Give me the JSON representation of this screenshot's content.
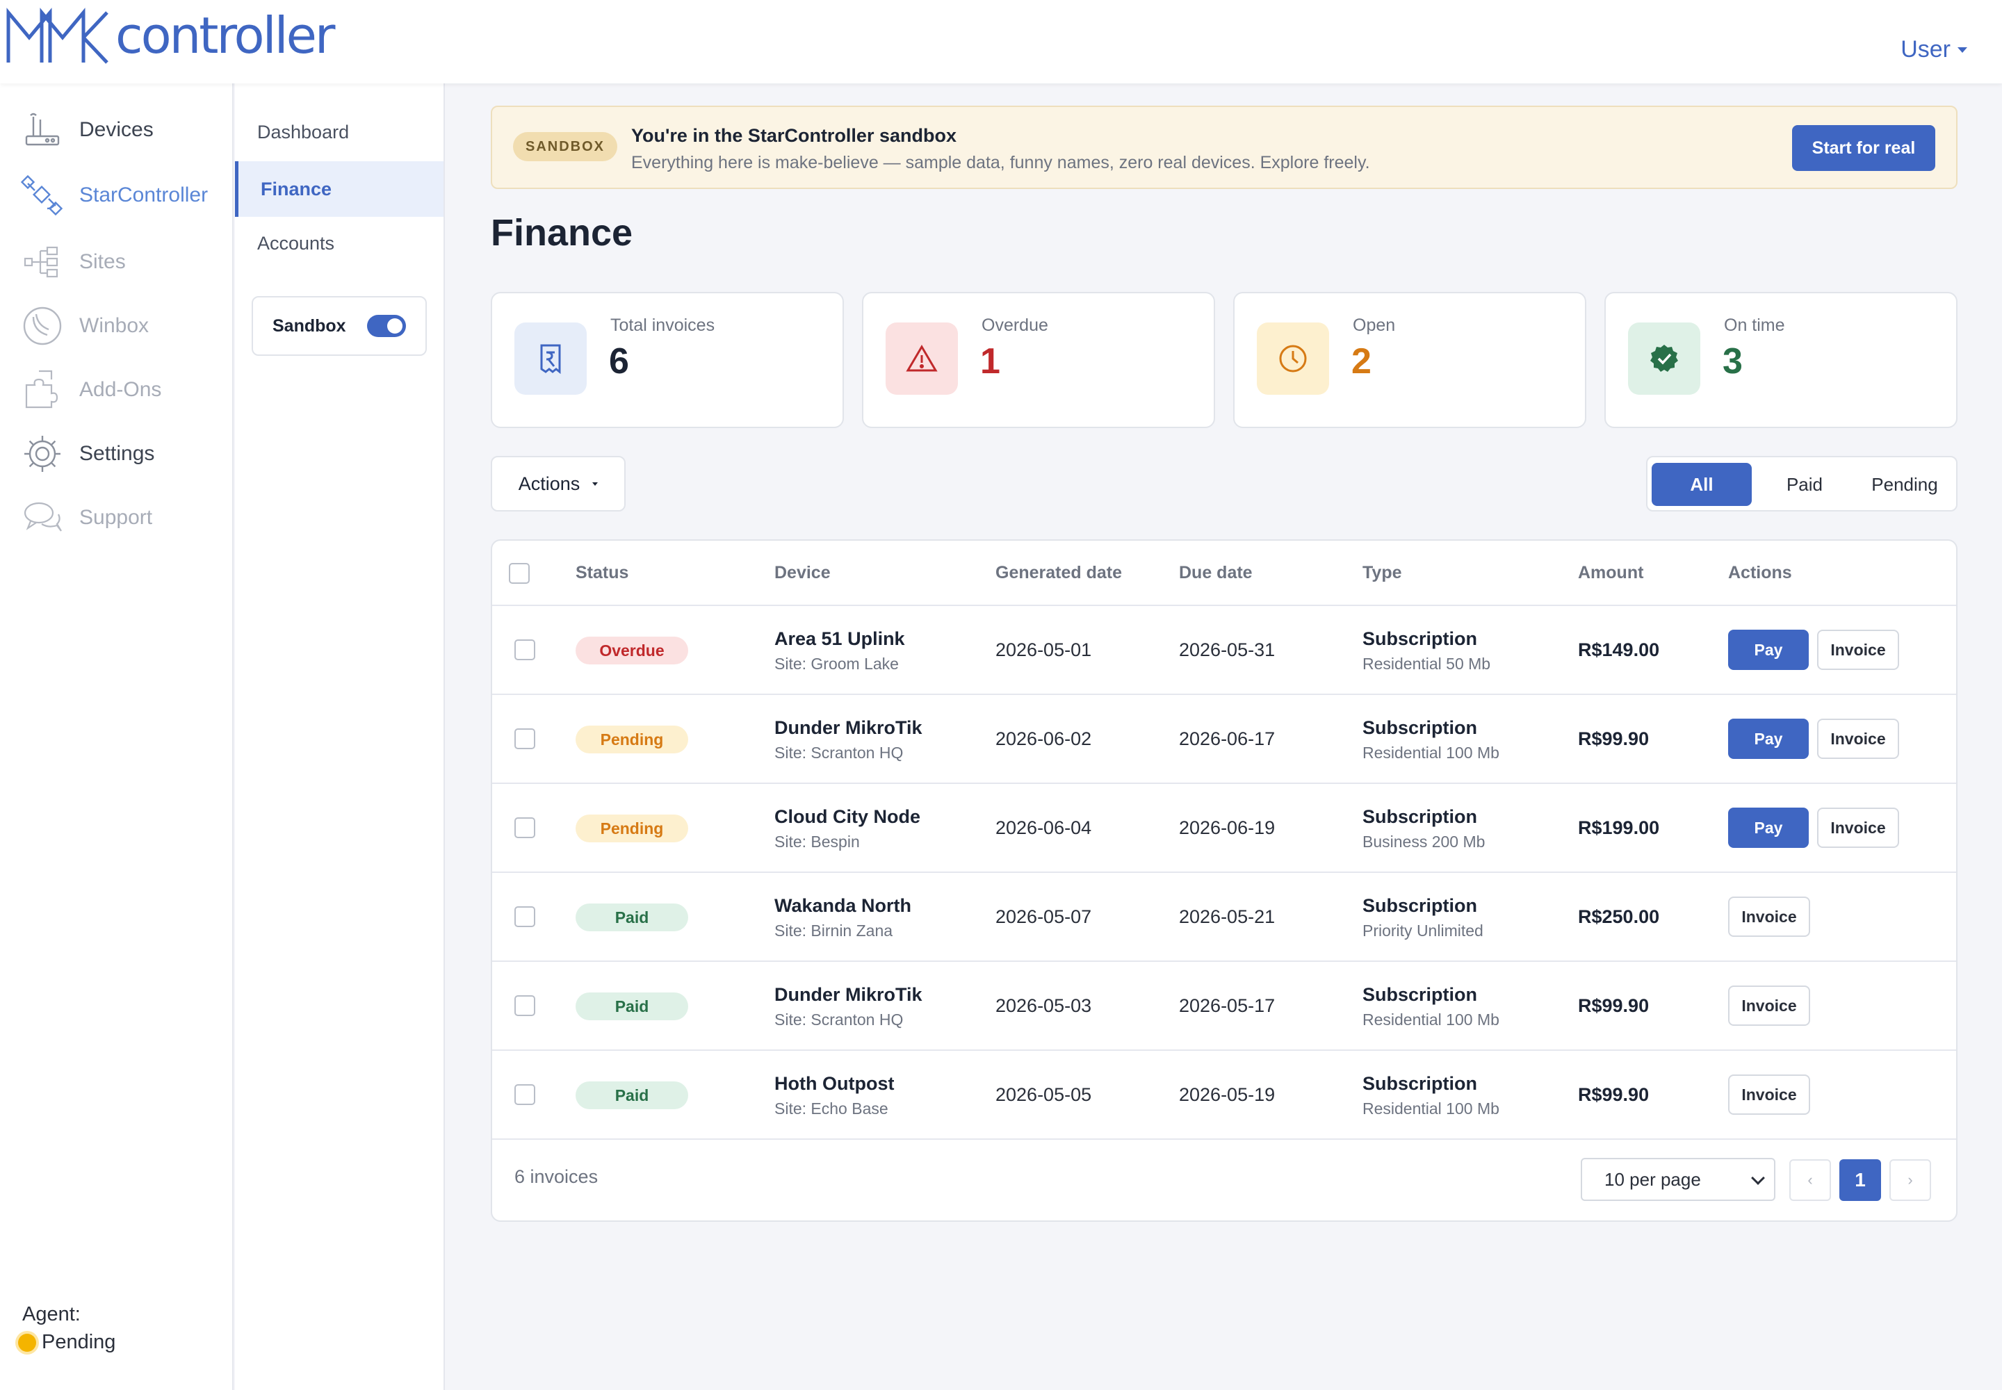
{
  "app": {
    "logo_text": "controller",
    "user_menu": "User"
  },
  "sidebar": {
    "items": [
      {
        "label": "Devices",
        "icon": "router-icon"
      },
      {
        "label": "StarController",
        "icon": "satellite-icon"
      },
      {
        "label": "Sites",
        "icon": "sitemap-icon"
      },
      {
        "label": "Winbox",
        "icon": "winbox-icon"
      },
      {
        "label": "Add-Ons",
        "icon": "puzzle-icon"
      },
      {
        "label": "Settings",
        "icon": "gear-icon"
      },
      {
        "label": "Support",
        "icon": "chat-icon"
      }
    ],
    "agent_label": "Agent:",
    "agent_status": "Pending"
  },
  "subnav": {
    "items": [
      {
        "label": "Dashboard"
      },
      {
        "label": "Finance"
      },
      {
        "label": "Accounts"
      }
    ],
    "sandbox_label": "Sandbox",
    "sandbox_on": true
  },
  "banner": {
    "badge": "SANDBOX",
    "title": "You're in the StarController sandbox",
    "text": "Everything here is make-believe — sample data, funny names, zero real devices. Explore freely.",
    "button": "Start for real"
  },
  "page": {
    "title": "Finance"
  },
  "stats": [
    {
      "label": "Total invoices",
      "value": "6",
      "icon": "receipt-icon",
      "color": "#1c2434",
      "bg": "#e6edf9",
      "icon_color": "#3f66c2"
    },
    {
      "label": "Overdue",
      "value": "1",
      "icon": "warning-icon",
      "color": "#c0292b",
      "bg": "#fbe1e1",
      "icon_color": "#c0292b"
    },
    {
      "label": "Open",
      "value": "2",
      "icon": "clock-icon",
      "color": "#d67a14",
      "bg": "#fdf0cf",
      "icon_color": "#d67a14"
    },
    {
      "label": "On time",
      "value": "3",
      "icon": "check-circle-icon",
      "color": "#287048",
      "bg": "#dff1e7",
      "icon_color": "#287048"
    }
  ],
  "toolbar": {
    "actions_label": "Actions",
    "filters": [
      {
        "label": "All",
        "active": true
      },
      {
        "label": "Paid",
        "active": false
      },
      {
        "label": "Pending",
        "active": false
      }
    ]
  },
  "table": {
    "columns": [
      "Status",
      "Device",
      "Generated date",
      "Due date",
      "Type",
      "Amount",
      "Actions"
    ],
    "pay_label": "Pay",
    "invoice_label": "Invoice",
    "rows": [
      {
        "status": "Overdue",
        "status_kind": "overdue",
        "device": "Area 51 Uplink",
        "site": "Site: Groom Lake",
        "generated": "2026-05-01",
        "due": "2026-05-31",
        "type": "Subscription",
        "plan": "Residential 50 Mb",
        "amount": "R$149.00",
        "payable": true
      },
      {
        "status": "Pending",
        "status_kind": "pending",
        "device": "Dunder MikroTik",
        "site": "Site: Scranton HQ",
        "generated": "2026-06-02",
        "due": "2026-06-17",
        "type": "Subscription",
        "plan": "Residential 100 Mb",
        "amount": "R$99.90",
        "payable": true
      },
      {
        "status": "Pending",
        "status_kind": "pending",
        "device": "Cloud City Node",
        "site": "Site: Bespin",
        "generated": "2026-06-04",
        "due": "2026-06-19",
        "type": "Subscription",
        "plan": "Business 200 Mb",
        "amount": "R$199.00",
        "payable": true
      },
      {
        "status": "Paid",
        "status_kind": "paid",
        "device": "Wakanda North",
        "site": "Site: Birnin Zana",
        "generated": "2026-05-07",
        "due": "2026-05-21",
        "type": "Subscription",
        "plan": "Priority Unlimited",
        "amount": "R$250.00",
        "payable": false
      },
      {
        "status": "Paid",
        "status_kind": "paid",
        "device": "Dunder MikroTik",
        "site": "Site: Scranton HQ",
        "generated": "2026-05-03",
        "due": "2026-05-17",
        "type": "Subscription",
        "plan": "Residential 100 Mb",
        "amount": "R$99.90",
        "payable": false
      },
      {
        "status": "Paid",
        "status_kind": "paid",
        "device": "Hoth Outpost",
        "site": "Site: Echo Base",
        "generated": "2026-05-05",
        "due": "2026-05-19",
        "type": "Subscription",
        "plan": "Residential 100 Mb",
        "amount": "R$99.90",
        "payable": false
      }
    ],
    "footer_count": "6 invoices",
    "per_page": "10 per page",
    "prev": "‹",
    "current_page": "1",
    "next": "›"
  },
  "colors": {
    "accent": "#3f66c2",
    "banner_bg": "#fbf4e4"
  }
}
